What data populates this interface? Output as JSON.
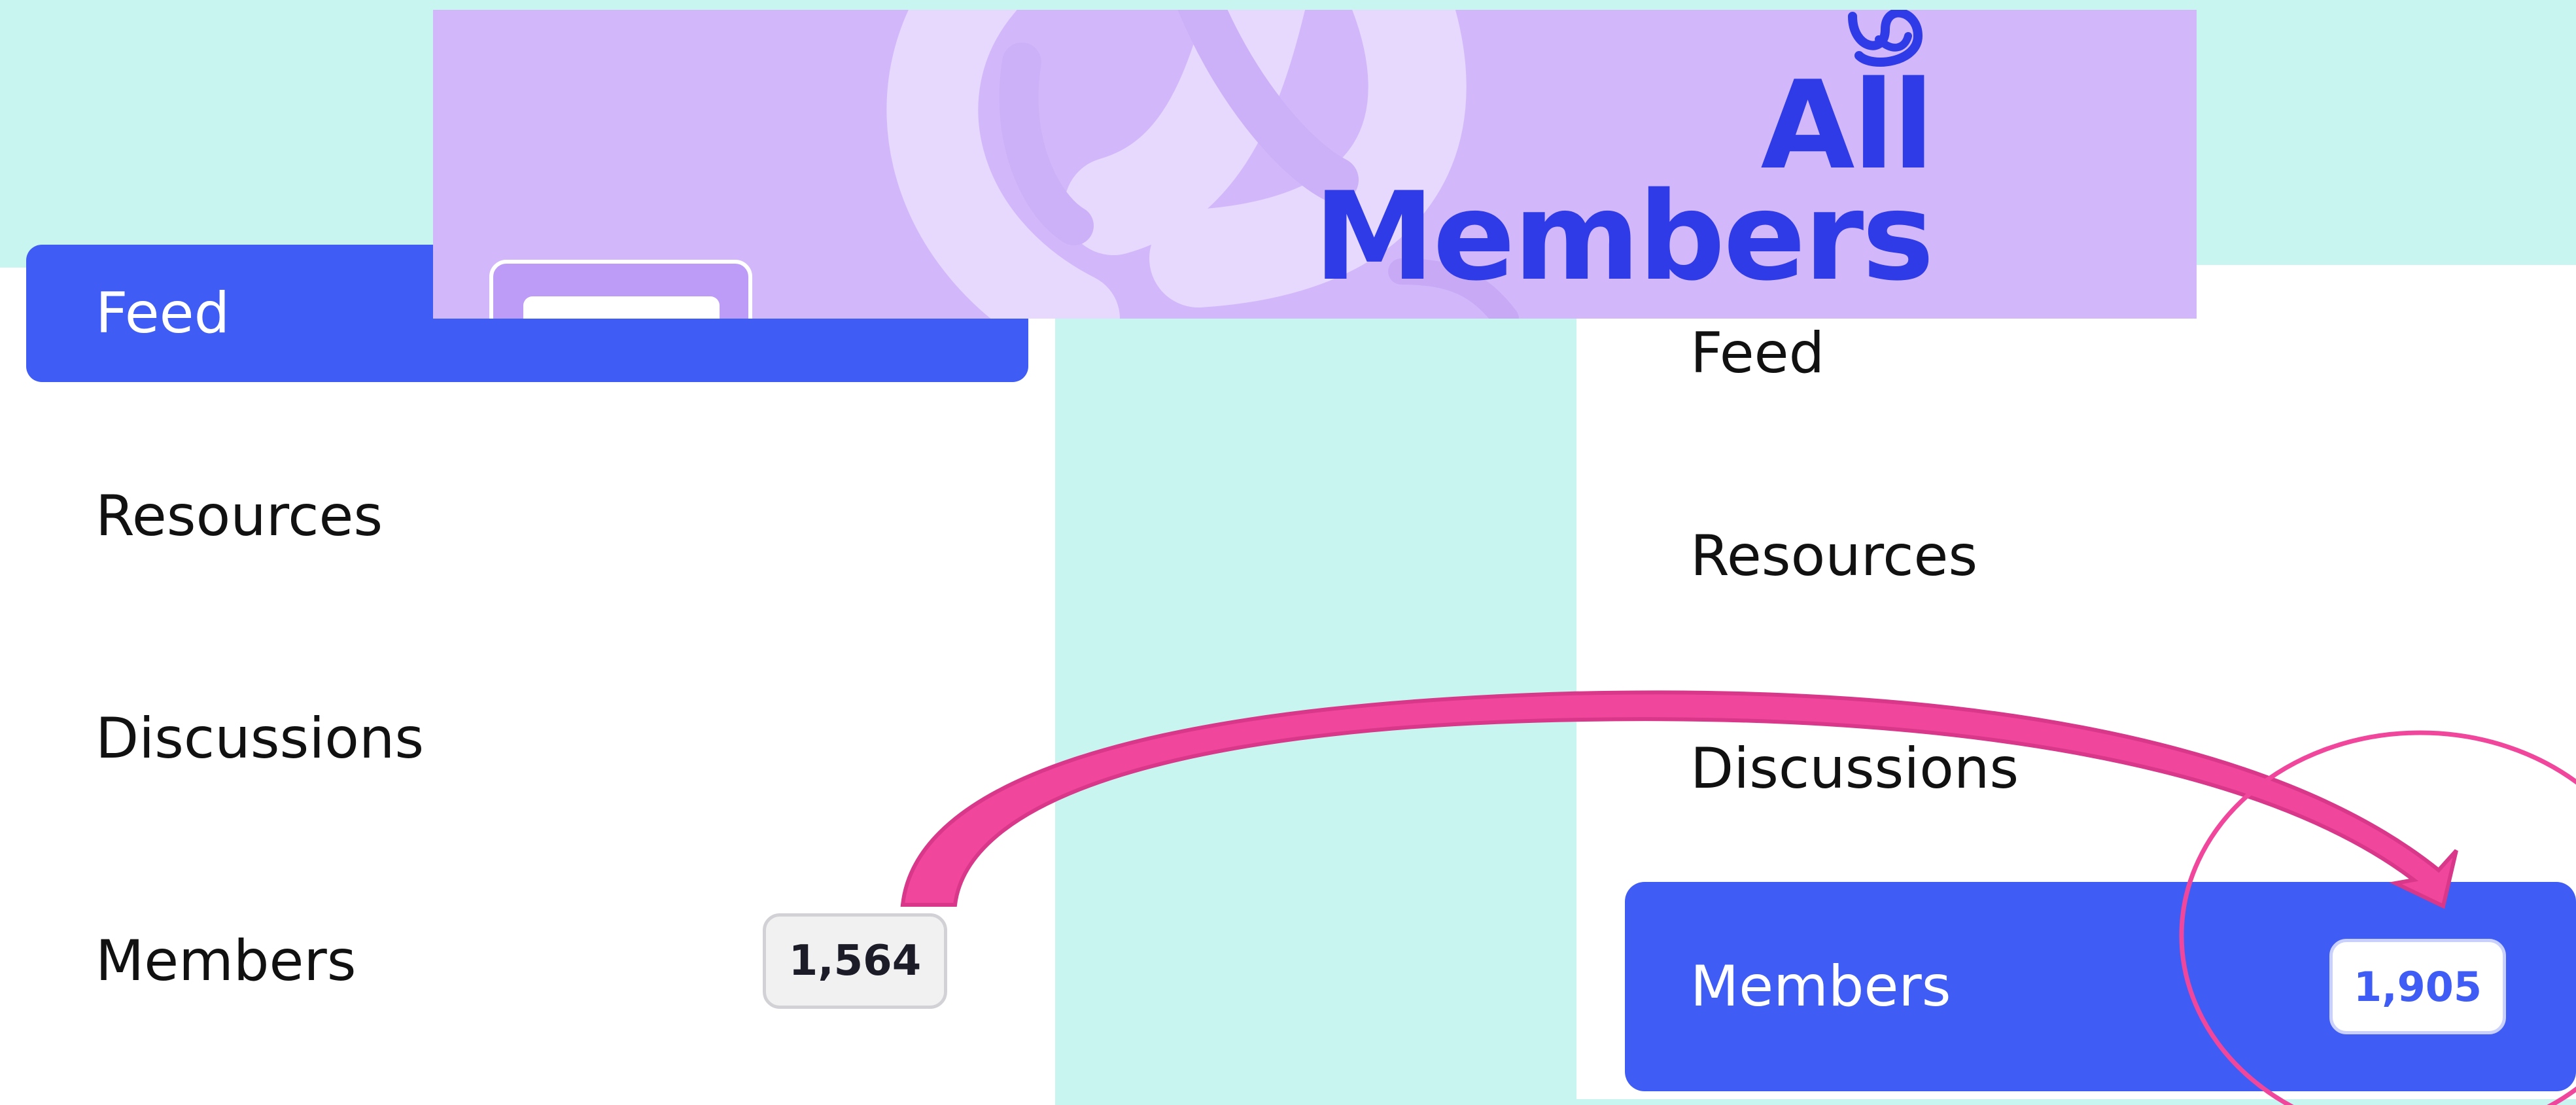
{
  "banner": {
    "title_line1": "All",
    "title_line2": "Members",
    "bg_color": "#d2b8fa",
    "title_color": "#2e3be6"
  },
  "left_nav": {
    "items": [
      {
        "label": "Feed",
        "active": true
      },
      {
        "label": "Resources",
        "active": false
      },
      {
        "label": "Discussions",
        "active": false
      },
      {
        "label": "Members",
        "active": false,
        "count": "1,564"
      }
    ]
  },
  "right_nav": {
    "items": [
      {
        "label": "Feed",
        "active": false
      },
      {
        "label": "Resources",
        "active": false
      },
      {
        "label": "Discussions",
        "active": false
      },
      {
        "label": "Members",
        "active": true,
        "count": "1,905"
      }
    ]
  },
  "colors": {
    "background": "#c9f5f0",
    "accent": "#3f5cf5",
    "annotation": "#f0479c"
  },
  "icons": {
    "banner_glyph": "curly-logo-icon",
    "annotation_arrow": "curved-arrow-icon",
    "annotation_circle": "highlight-circle-icon"
  }
}
